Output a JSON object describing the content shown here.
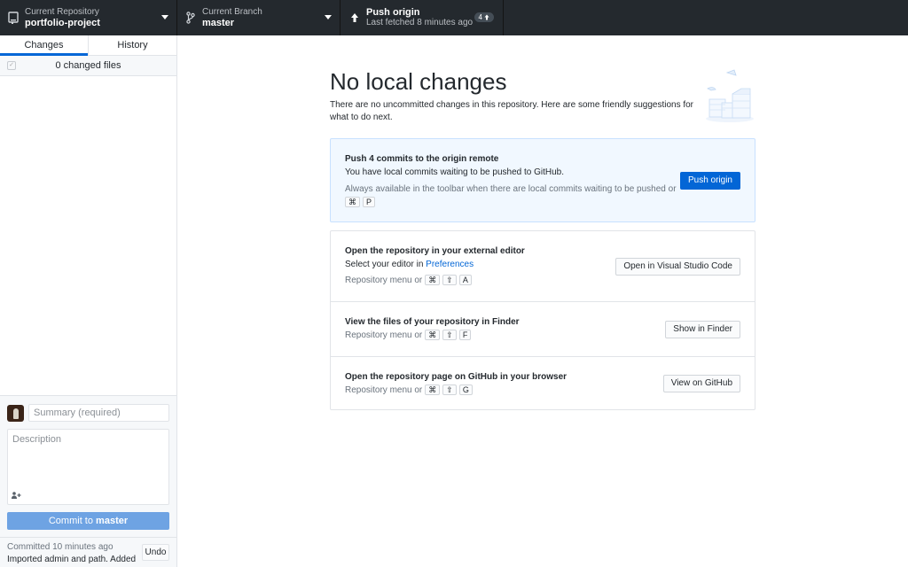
{
  "toolbar": {
    "repository": {
      "label": "Current Repository",
      "value": "portfolio-project",
      "icon": "repo-icon"
    },
    "branch": {
      "label": "Current Branch",
      "value": "master",
      "icon": "branch-icon"
    },
    "push": {
      "label": "Push origin",
      "sublabel": "Last fetched 8 minutes ago",
      "icon": "arrow-up-icon",
      "badge_count": "4",
      "badge_icon": "arrow-up-small-icon"
    }
  },
  "sidebar": {
    "tabs": [
      {
        "label": "Changes",
        "active": true
      },
      {
        "label": "History",
        "active": false
      }
    ],
    "changes_header": {
      "count_label": "0 changed files",
      "checkbox_glyph": "✓"
    },
    "commit": {
      "summary_placeholder": "Summary (required)",
      "description_placeholder": "Description",
      "coauthor_glyph": "👤+",
      "button_prefix": "Commit to ",
      "button_branch": "master"
    },
    "last_commit": {
      "time": "Committed 10 minutes ago",
      "message": "Imported admin and path. Added u...",
      "undo_label": "Undo"
    }
  },
  "main": {
    "title": "No local changes",
    "subtitle": "There are no uncommitted changes in this repository. Here are some friendly suggestions for what to do next.",
    "push_card": {
      "title": "Push 4 commits to the origin remote",
      "description": "You have local commits waiting to be pushed to GitHub.",
      "hint": "Always available in the toolbar when there are local commits waiting to be pushed or",
      "keys": [
        "⌘",
        "P"
      ],
      "button": "Push origin"
    },
    "actions": [
      {
        "title": "Open the repository in your external editor",
        "description_prefix": "Select your editor in ",
        "description_link": "Preferences",
        "hint": "Repository menu or",
        "keys": [
          "⌘",
          "⇧",
          "A"
        ],
        "button": "Open in Visual Studio Code"
      },
      {
        "title": "View the files of your repository in Finder",
        "hint": "Repository menu or",
        "keys": [
          "⌘",
          "⇧",
          "F"
        ],
        "button": "Show in Finder"
      },
      {
        "title": "Open the repository page on GitHub in your browser",
        "hint": "Repository menu or",
        "keys": [
          "⌘",
          "⇧",
          "G"
        ],
        "button": "View on GitHub"
      }
    ]
  },
  "colors": {
    "toolbar_bg": "#24292e",
    "accent": "#0366d6",
    "commit_button_disabled": "#6ea3e3",
    "push_card_bg": "#f1f8ff"
  }
}
